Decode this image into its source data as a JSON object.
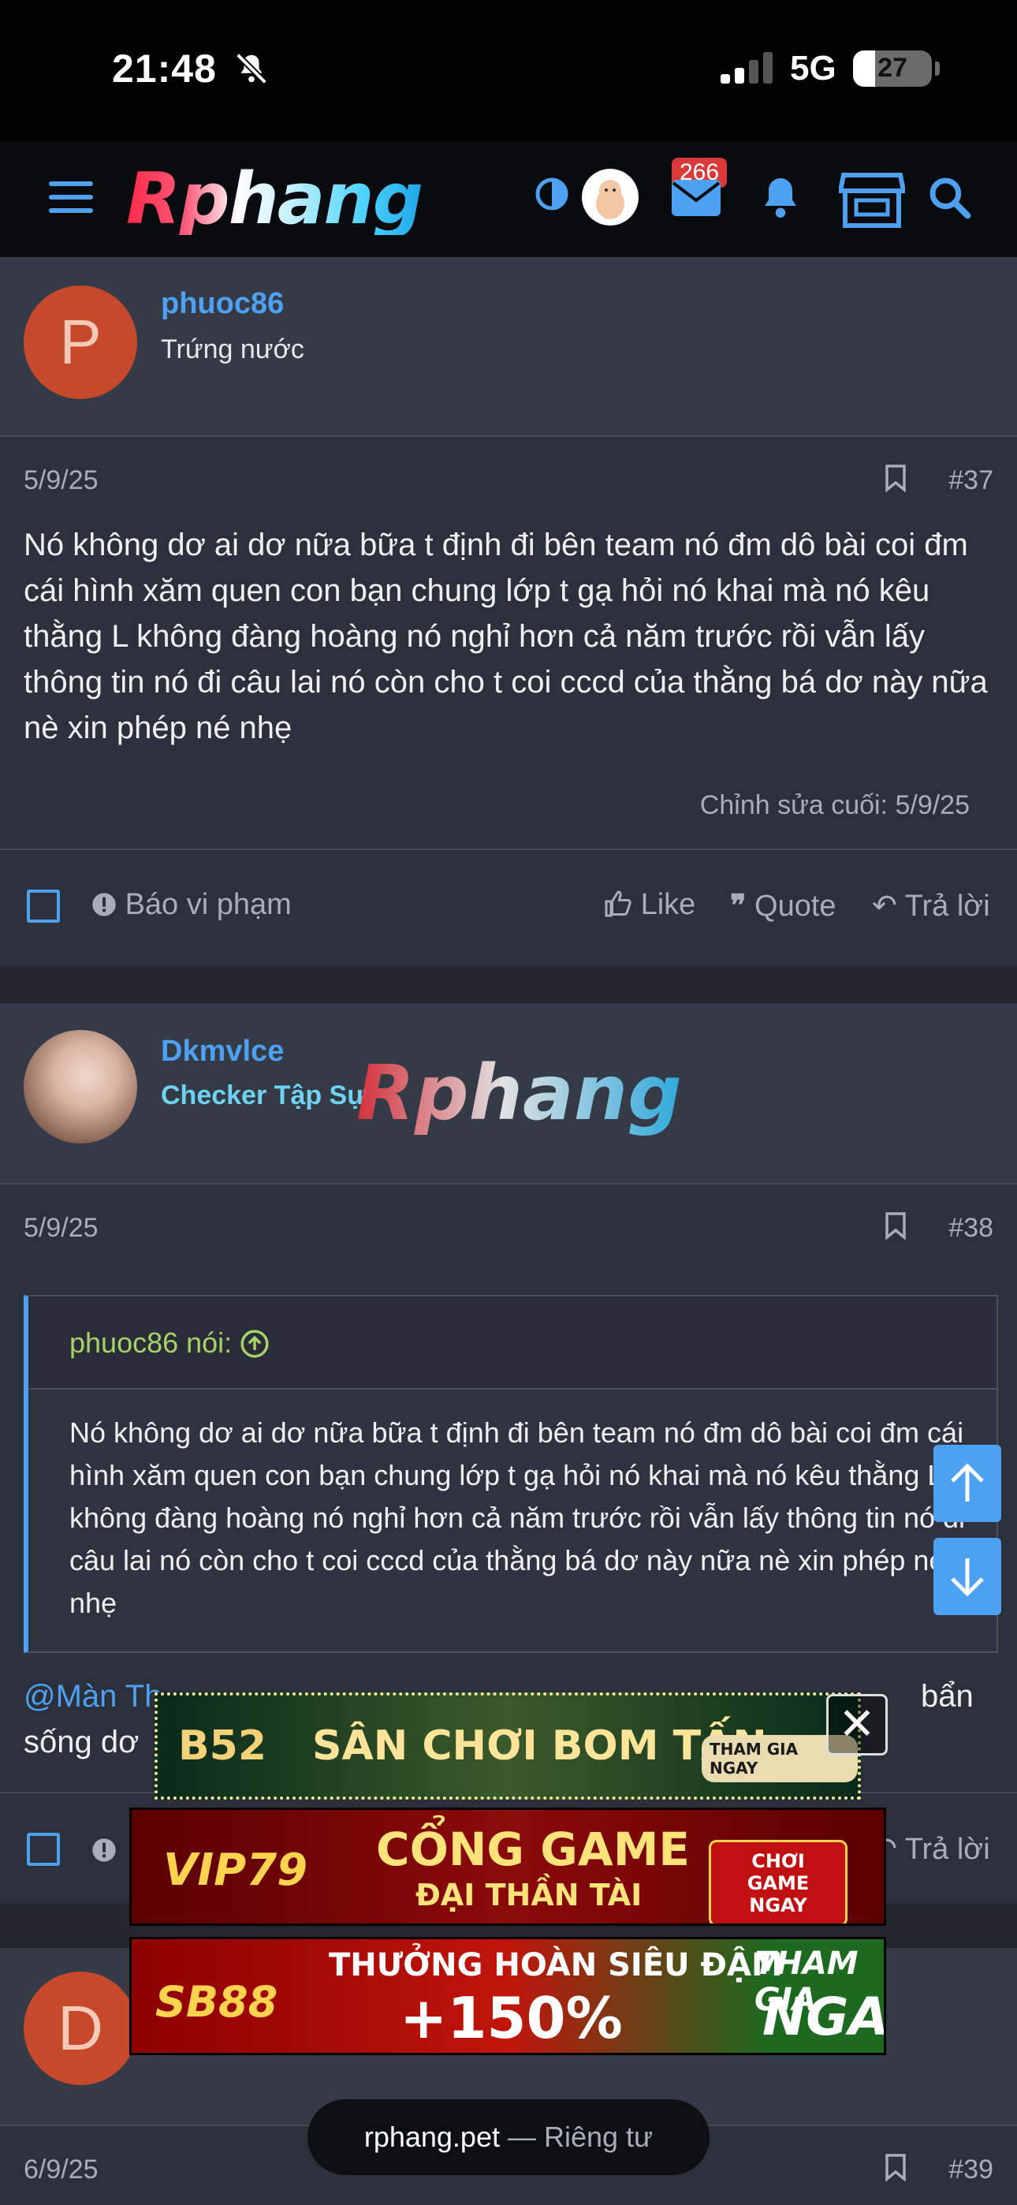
{
  "status": {
    "time": "21:48",
    "network": "5G",
    "battery": "27",
    "battery_level": 0.27
  },
  "nav": {
    "logo": "Rphang",
    "mail_badge": "266"
  },
  "posts": [
    {
      "author": "phuoc86",
      "avatar_letter": "P",
      "user_title": "Trứng nước",
      "date": "5/9/25",
      "number": "#37",
      "text": "Nó không dơ ai dơ nữa bữa t định đi bên team nó đm dô bài coi đm cái hình xăm quen con bạn chung lớp t gạ hỏi nó khai mà nó kêu thằng L không đàng hoàng nó nghỉ hơn cả năm trước rồi vẫn lấy thông tin nó đi câu lai nó còn cho t coi cccd của thằng bá dơ này nữa nè xin phép né nhẹ",
      "edited": "Chỉnh sửa cuối: 5/9/25"
    },
    {
      "author": "Dkmvlce",
      "user_title": "Checker Tập Sự",
      "date": "5/9/25",
      "number": "#38",
      "quote_author": "phuoc86 nói:",
      "quote_text": "Nó không dơ ai dơ nữa bữa t định đi bên team nó đm dô bài coi đm cái hình xăm quen con bạn chung lớp t gạ hỏi nó khai mà nó kêu thằng L không đàng hoàng nó nghỉ hơn cả năm trước rồi vẫn lấy thông tin nó đi câu lai nó còn cho t coi cccd của thằng bá dơ này nữa nè xin phép né nhẹ",
      "mention": "@Màn Th",
      "reply_tail_line1": "bẩn",
      "reply_line2": "sống dơ"
    },
    {
      "avatar_letter": "D",
      "date": "6/9/25",
      "number": "#39"
    }
  ],
  "actions": {
    "report": "Báo vi phạm",
    "like": "Like",
    "quote": "Quote",
    "reply": "Trả lời"
  },
  "watermark": "Rphang",
  "ads": {
    "b52": {
      "brand": "B52",
      "headline": "SÂN CHƠI BOM TẤN",
      "cta": "THAM GIA NGAY"
    },
    "vip79": {
      "brand": "VIP79",
      "headline1": "CỔNG GAME",
      "headline2": "ĐẠI THẦN TÀI",
      "cta": "CHƠI GAME NGAY"
    },
    "sb88": {
      "brand": "SB88",
      "headline1": "THƯỞNG HOÀN SIÊU ĐẬM",
      "headline2": "+150%",
      "cta1": "THAM GIA",
      "cta2": "NGAY"
    },
    "close": "✕"
  },
  "url": {
    "host": "rphang.pet",
    "privacy": " — Riêng tư"
  }
}
